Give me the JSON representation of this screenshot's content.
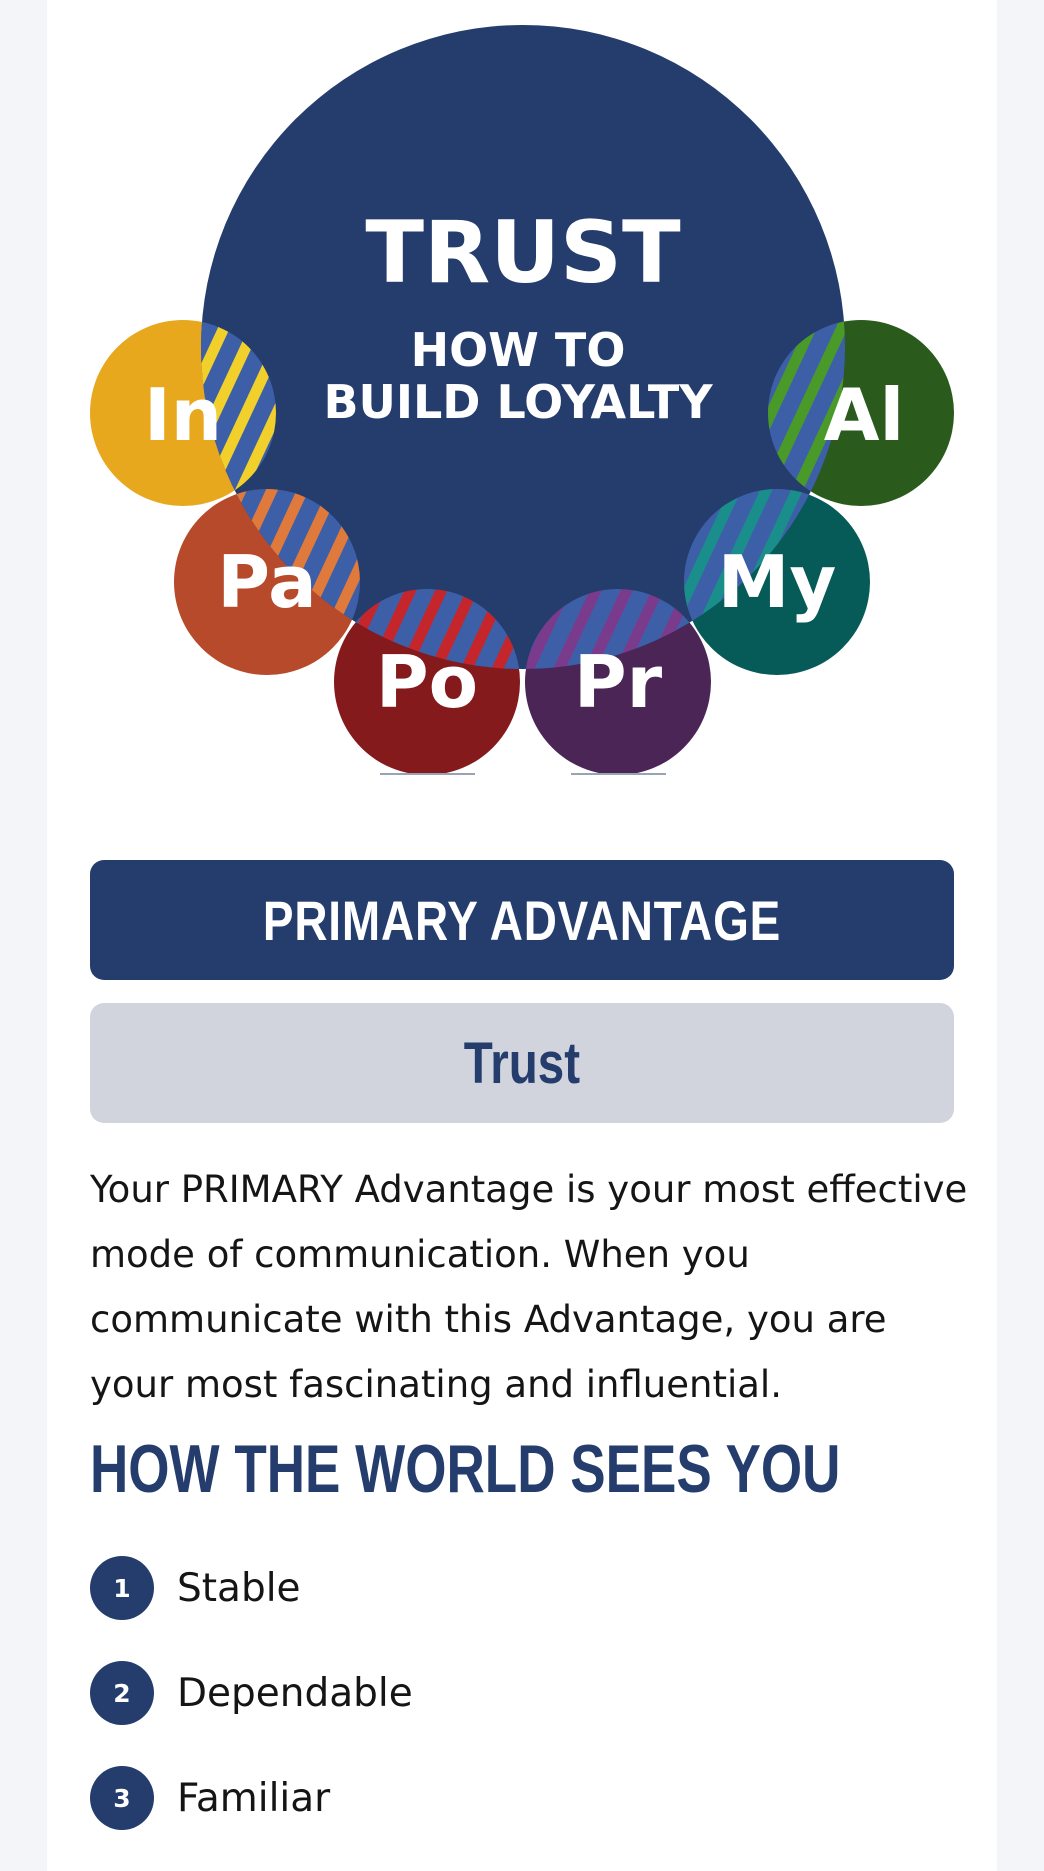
{
  "diagram": {
    "title": "TRUST",
    "subtitle_line1": "HOW TO",
    "subtitle_line2": "BUILD LOYALTY",
    "center_color": "#243d6d",
    "advantages": [
      {
        "abbr": "In",
        "color": "#e8a81e",
        "stripe": "#f2d02b"
      },
      {
        "abbr": "Pa",
        "color": "#b64a2a",
        "stripe": "#e07a3c"
      },
      {
        "abbr": "Po",
        "color": "#841a1c",
        "stripe": "#c4262b"
      },
      {
        "abbr": "Pr",
        "color": "#4a2556",
        "stripe": "#7a3b8c"
      },
      {
        "abbr": "My",
        "color": "#065a58",
        "stripe": "#1a8e8a"
      },
      {
        "abbr": "Al",
        "color": "#2a5a1c",
        "stripe": "#4a9a2a"
      }
    ]
  },
  "primary": {
    "heading": "PRIMARY ADVANTAGE",
    "value": "Trust",
    "description": "Your PRIMARY Advantage is your most effective mode of communication. When you communicate with this Advantage, you are your most fascinating and influential."
  },
  "world": {
    "heading": "HOW THE WORLD SEES YOU",
    "traits": [
      {
        "num": "1",
        "label": "Stable"
      },
      {
        "num": "2",
        "label": "Dependable"
      },
      {
        "num": "3",
        "label": "Familiar"
      }
    ]
  },
  "colors": {
    "navy": "#243d6d",
    "gray_box": "#d1d4dc",
    "page_bg": "#f3f5f8"
  }
}
